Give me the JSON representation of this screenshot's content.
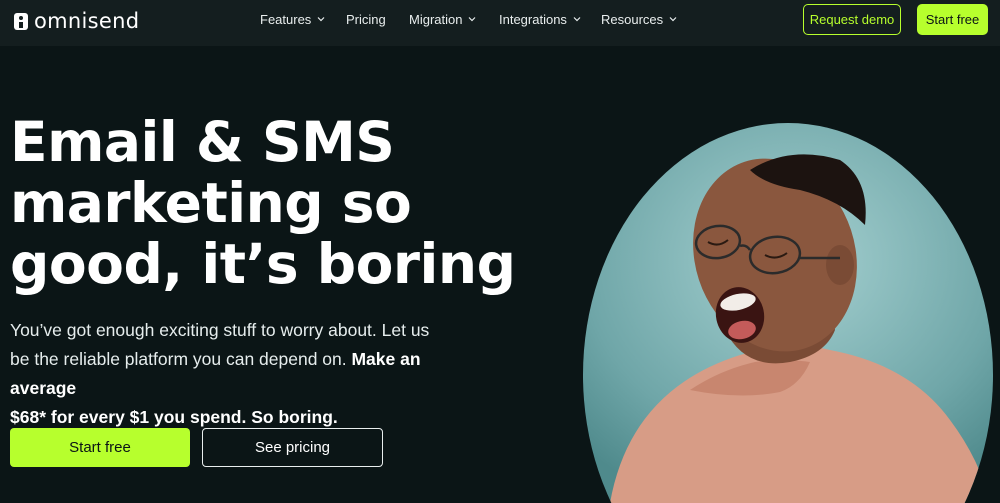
{
  "brand": {
    "name": "omnisend",
    "accent": "#b7ff2d",
    "background": "#0b1516"
  },
  "nav": {
    "items": [
      {
        "label": "Features",
        "dropdown": true
      },
      {
        "label": "Pricing",
        "dropdown": false
      },
      {
        "label": "Migration",
        "dropdown": true
      },
      {
        "label": "Integrations",
        "dropdown": true
      },
      {
        "label": "Resources",
        "dropdown": true
      }
    ],
    "request_demo": "Request demo",
    "start_free": "Start free"
  },
  "hero": {
    "headline": [
      "Email & SMS",
      "marketing so",
      "good, it’s boring"
    ],
    "subcopy_plain": "You’ve got enough exciting stuff to worry about. Let us be the reliable platform you can depend on. ",
    "subcopy_bold": "Make an average",
    "subcopy_end": "$68* for every $1 you spend. So boring.",
    "primary_cta": "Start free",
    "secondary_cta": "See pricing"
  },
  "icons": [
    "omnisend-logo-icon",
    "chevron-down-icon"
  ]
}
